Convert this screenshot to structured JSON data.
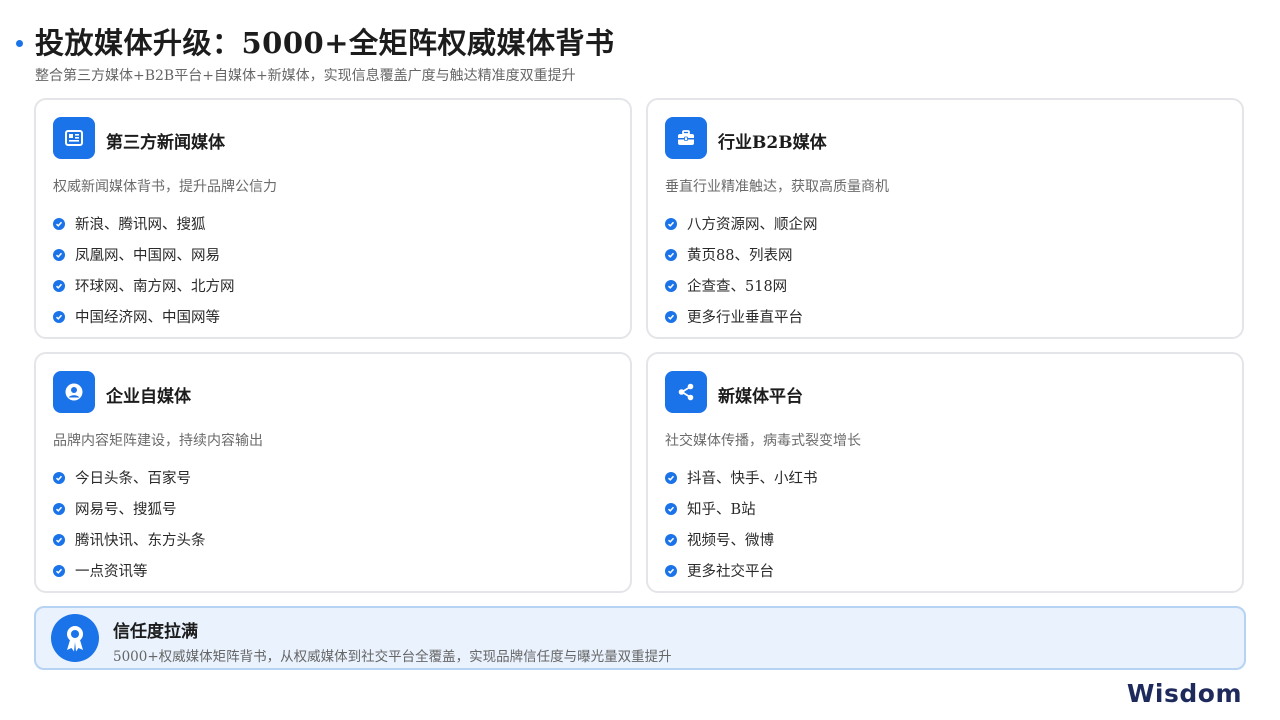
{
  "header": {
    "title": "投放媒体升级：5000+全矩阵权威媒体背书",
    "subtitle": "整合第三方媒体+B2B平台+自媒体+新媒体，实现信息覆盖广度与触达精准度双重提升"
  },
  "cards": [
    {
      "icon": "newspaper-icon",
      "title": "第三方新闻媒体",
      "desc": "权威新闻媒体背书，提升品牌公信力",
      "items": [
        "新浪、腾讯网、搜狐",
        "凤凰网、中国网、网易",
        "环球网、南方网、北方网",
        "中国经济网、中国网等"
      ]
    },
    {
      "icon": "briefcase-icon",
      "title": "行业B2B媒体",
      "desc": "垂直行业精准触达，获取高质量商机",
      "items": [
        "八方资源网、顺企网",
        "黄页88、列表网",
        "企查查、518网",
        "更多行业垂直平台"
      ]
    },
    {
      "icon": "user-circle-icon",
      "title": "企业自媒体",
      "desc": "品牌内容矩阵建设，持续内容输出",
      "items": [
        "今日头条、百家号",
        "网易号、搜狐号",
        "腾讯快讯、东方头条",
        "一点资讯等"
      ]
    },
    {
      "icon": "share-icon",
      "title": "新媒体平台",
      "desc": "社交媒体传播，病毒式裂变增长",
      "items": [
        "抖音、快手、小红书",
        "知乎、B站",
        "视频号、微博",
        "更多社交平台"
      ]
    }
  ],
  "banner": {
    "icon": "award-icon",
    "title": "信任度拉满",
    "text": "5000+权威媒体矩阵背书，从权威媒体到社交平台全覆盖，实现品牌信任度与曝光量双重提升"
  },
  "logo": {
    "text": "Wisdom"
  },
  "colors": {
    "accent": "#1a73e8",
    "banner_bg": "#e9f2fd",
    "card_border": "#e3e5e8"
  }
}
